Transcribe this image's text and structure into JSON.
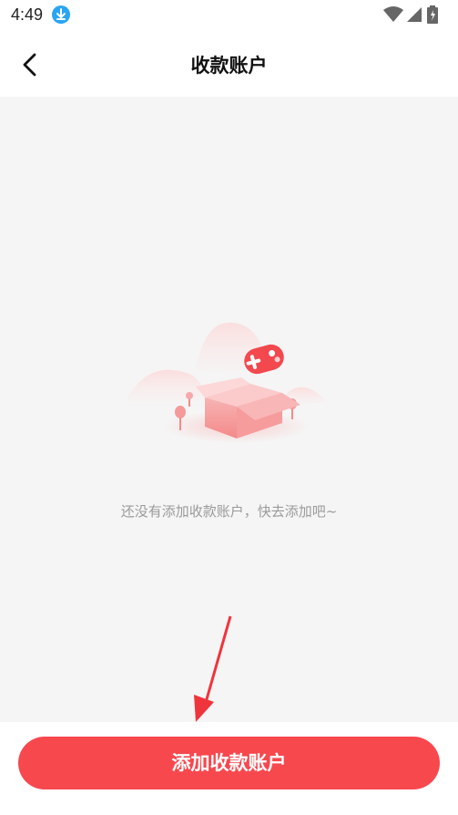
{
  "status_bar": {
    "time": "4:49",
    "icons": [
      "download-icon",
      "wifi-icon",
      "signal-icon",
      "battery-icon"
    ]
  },
  "header": {
    "title": "收款账户",
    "back_icon": "chevron-left-icon"
  },
  "empty_state": {
    "message": "还没有添加收款账户，快去添加吧~",
    "illustration": "open-box-with-gamepad-icon"
  },
  "footer": {
    "add_button_label": "添加收款账户",
    "accent_color": "#f7484e"
  }
}
